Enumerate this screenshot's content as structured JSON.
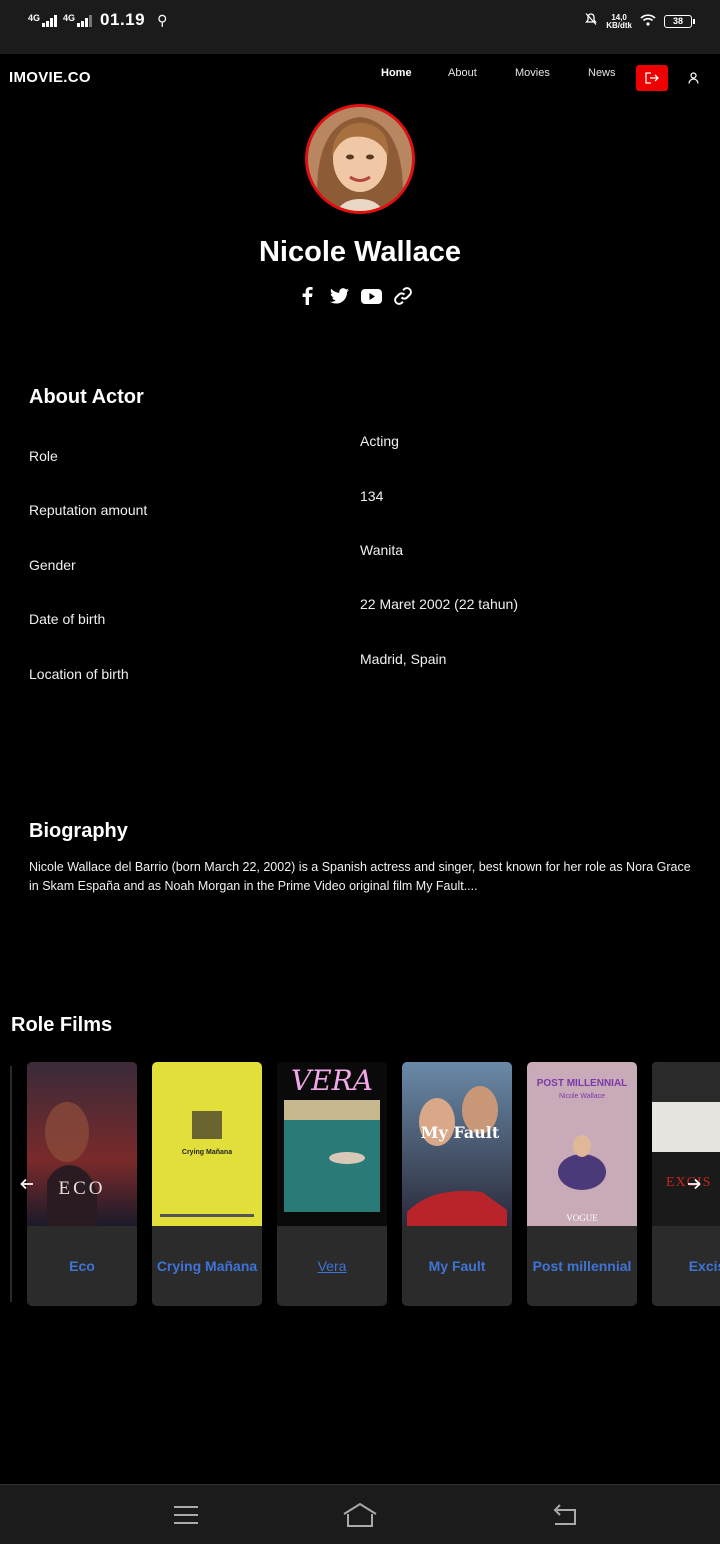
{
  "status_bar": {
    "signal_1": "4G",
    "signal_2": "4G",
    "time": "01.19",
    "speed_value": "14,0",
    "speed_unit": "KB/dtk",
    "battery": "38"
  },
  "nav": {
    "brand": "IMOVIE.CO",
    "links": [
      {
        "label": "Home",
        "active": true
      },
      {
        "label": "About"
      },
      {
        "label": "Movies"
      },
      {
        "label": "News"
      }
    ],
    "logout_icon": "logout-icon",
    "user_icon": "user-icon"
  },
  "profile": {
    "name": "Nicole Wallace",
    "social": [
      "facebook-icon",
      "twitter-icon",
      "youtube-icon",
      "link-icon"
    ]
  },
  "about": {
    "title": "About Actor",
    "rows": [
      {
        "label": "Role",
        "value": "Acting"
      },
      {
        "label": "Reputation amount",
        "value": "134"
      },
      {
        "label": "Gender",
        "value": "Wanita"
      },
      {
        "label": "Date of birth",
        "value": "22 Maret 2002 (22 tahun)"
      },
      {
        "label": "Location of birth",
        "value": "Madrid, Spain"
      }
    ]
  },
  "biography": {
    "title": "Biography",
    "text": "Nicole Wallace del Barrio (born March 22, 2002) is a Spanish actress and singer, best known for her role as Nora Grace in Skam España and as Noah Morgan in the Prime Video original film My Fault...."
  },
  "role_films": {
    "title": "Role Films",
    "films": [
      {
        "title": "Eco",
        "poster_text": "ECO"
      },
      {
        "title": "Crying Mañana",
        "poster_text": "Crying Mañana"
      },
      {
        "title": "Vera",
        "poster_text": "VERA"
      },
      {
        "title": "My Fault",
        "poster_text": "My Fault"
      },
      {
        "title": "Post millennial",
        "poster_text": "POST MILLENNIAL",
        "poster_subtext": "Nicole Wallace",
        "poster_footer": "VOGUE"
      },
      {
        "title": "Excis",
        "poster_text": "EXCIS"
      }
    ],
    "prev_icon": "arrow-left-icon",
    "next_icon": "arrow-right-icon"
  },
  "system_nav": [
    "menu-icon",
    "home-icon",
    "back-icon"
  ]
}
